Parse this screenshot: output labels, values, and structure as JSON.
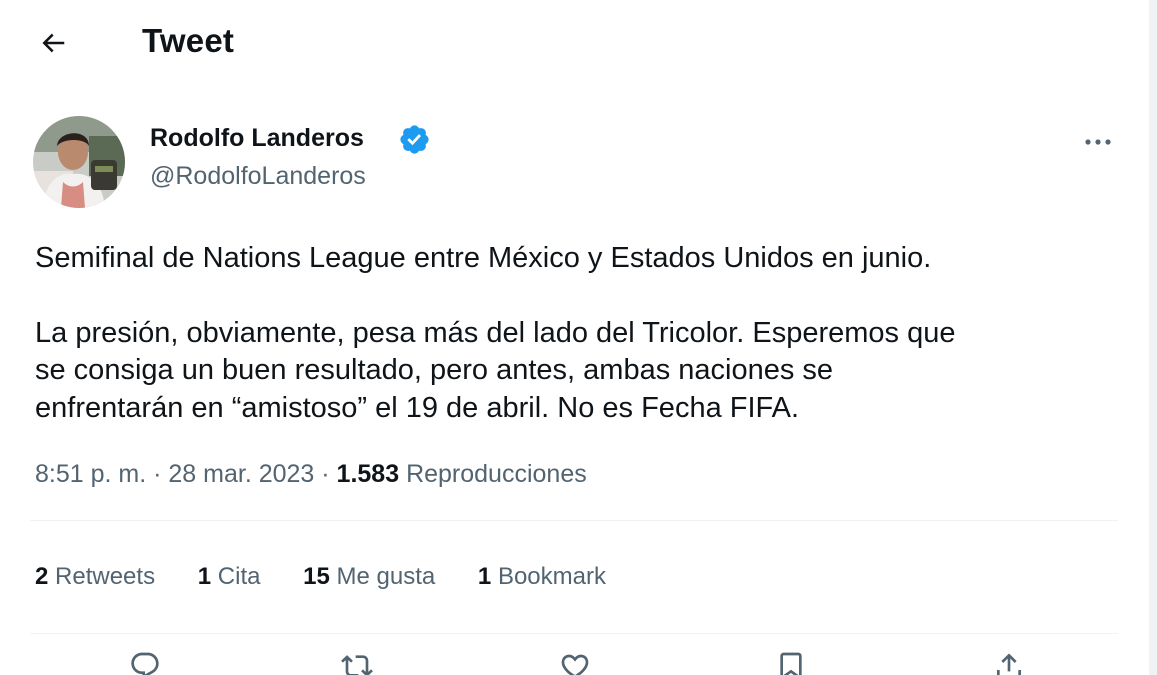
{
  "header": {
    "title": "Tweet",
    "back_icon": "arrow-left-icon"
  },
  "author": {
    "display_name": "Rodolfo Landeros",
    "handle": "@RodolfoLanderos",
    "verified_icon": "verified-badge-icon",
    "more_icon": "more-dots-icon"
  },
  "tweet": {
    "paragraph1": "Semifinal de Nations League entre México y Estados Unidos en junio.",
    "paragraph2_line1": "La presión, obviamente, pesa más del lado del Tricolor. Esperemos que",
    "paragraph2_line2": "se consiga un buen resultado, pero antes, ambas naciones se",
    "paragraph2_line3": "enfrentarán en “amistoso” el 19 de abril. No es Fecha FIFA."
  },
  "meta": {
    "time": "8:51 p. m.",
    "separator": " · ",
    "date": "28 mar. 2023",
    "views_count": "1.583",
    "views_label": "Reproducciones"
  },
  "stats": {
    "retweets_count": "2",
    "retweets_label": "Retweets",
    "quotes_count": "1",
    "quotes_label": "Cita",
    "likes_count": "15",
    "likes_label": "Me gusta",
    "bookmarks_count": "1",
    "bookmarks_label": "Bookmark"
  },
  "actions": [
    "reply-icon",
    "retweet-icon",
    "like-icon",
    "bookmark-icon",
    "share-icon"
  ],
  "colors": {
    "text_primary": "#0f1419",
    "text_secondary": "#536471",
    "verified_blue": "#1d9bf0",
    "divider": "#eff3f4"
  }
}
